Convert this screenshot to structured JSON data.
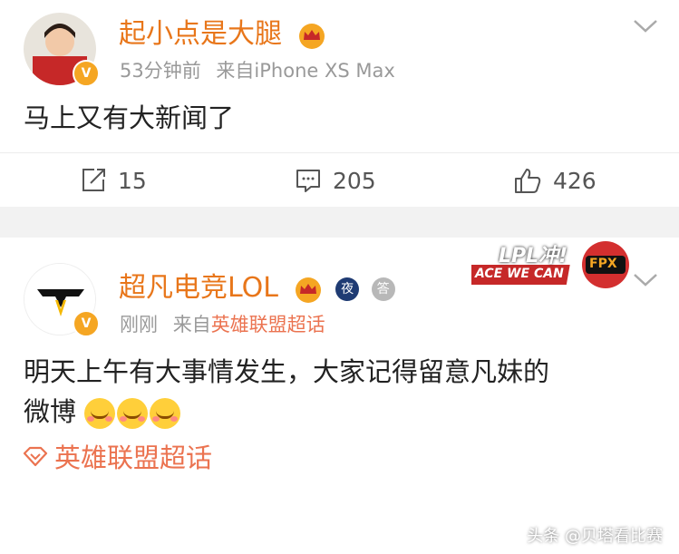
{
  "colors": {
    "username": "#e8761a",
    "meta": "#999999",
    "link": "#eb7350",
    "verified_badge": "#f5a623"
  },
  "post1": {
    "username": "起小点是大腿",
    "time": "53分钟前",
    "source_prefix": "来自",
    "source": "iPhone XS Max",
    "text": "马上又有大新闻了",
    "actions": {
      "repost_count": "15",
      "comment_count": "205",
      "like_count": "426"
    },
    "icons": [
      "crown-icon",
      "verified-icon",
      "chevron-down-icon",
      "repost-icon",
      "comment-icon",
      "like-icon"
    ]
  },
  "post2": {
    "username": "超凡电竞LOL",
    "badge_night": "夜",
    "badge_ans": "答",
    "time": "刚刚",
    "source_prefix": "来自",
    "source": "英雄联盟超话",
    "text_line1": "明天上午有大事情发生，大家记得留意凡妹的",
    "text_line2": "微博",
    "topic": "英雄联盟超话",
    "icons": [
      "crown-icon",
      "verified-icon",
      "chevron-down-icon",
      "drool-emoji-icon",
      "topic-diamond-icon"
    ]
  },
  "sticker": {
    "line1": "LPL冲!",
    "line2": "ACE WE CAN",
    "tag": "FPX"
  },
  "watermark": "头条 @贝塔看比赛"
}
